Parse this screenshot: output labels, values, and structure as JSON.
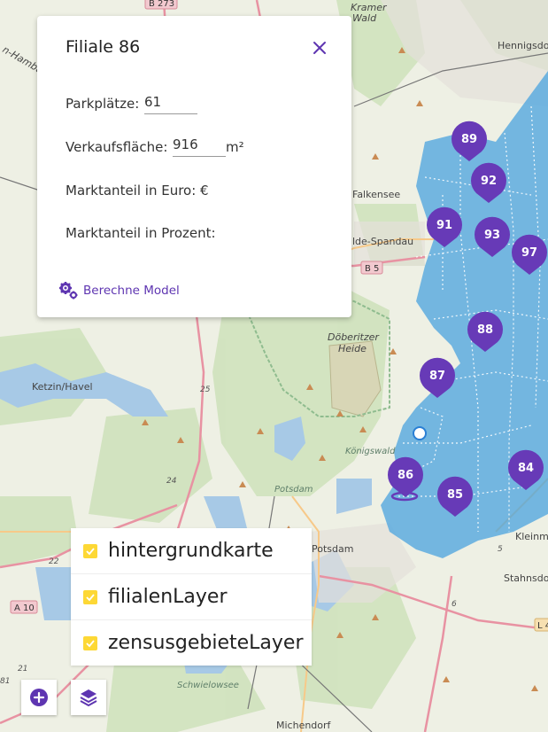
{
  "detail_panel": {
    "title": "Filiale 86",
    "parking_label": "Parkplätze:",
    "parking_value": "61",
    "sales_area_label": "Verkaufsfläche:",
    "sales_area_value": "916",
    "sales_area_unit": "m²",
    "market_share_euro_label": "Marktanteil in Euro: €",
    "market_share_percent_label": "Marktanteil in Prozent:",
    "calculate_label": "Berechne Model"
  },
  "layers": [
    {
      "label": "hintergrundkarte",
      "checked": true
    },
    {
      "label": "filialenLayer",
      "checked": true
    },
    {
      "label": "zensusgebieteLayer",
      "checked": true
    }
  ],
  "map": {
    "labels": {
      "kramer_wald": [
        "Kramer",
        "Wald"
      ],
      "hennigsdorf": "Hennigsdo",
      "falkensee": "Falkensee",
      "spandau": "lde-Spandau",
      "doeberitzer": [
        "Döberitzer",
        "Heide"
      ],
      "ketzin": "Ketzin/Havel",
      "potsdam": "Potsdam",
      "potsdam_green": "Potsdam",
      "koenigswald": "Königswald",
      "kleinm": "Kleinm",
      "stahnsdorf": "Stahnsdor",
      "michendorf": "Michendorf",
      "schwielowsee": "Schwielowsee",
      "hamburg": "n-Hamburg",
      "road_b5": "B 5",
      "road_b273": "B 273",
      "road_a10": "A 10",
      "road_l4": "L 4",
      "road_25": "25",
      "road_24": "24",
      "road_22": "22",
      "road_21": "21",
      "road_5": "5",
      "road_6": "6",
      "road_81": "81"
    },
    "markers": [
      {
        "id": "89"
      },
      {
        "id": "92"
      },
      {
        "id": "91"
      },
      {
        "id": "93"
      },
      {
        "id": "97"
      },
      {
        "id": "88"
      },
      {
        "id": "87"
      },
      {
        "id": "86"
      },
      {
        "id": "85"
      },
      {
        "id": "84"
      }
    ],
    "marker_color": "#673ab7",
    "zone_color": "#4aa3df"
  }
}
